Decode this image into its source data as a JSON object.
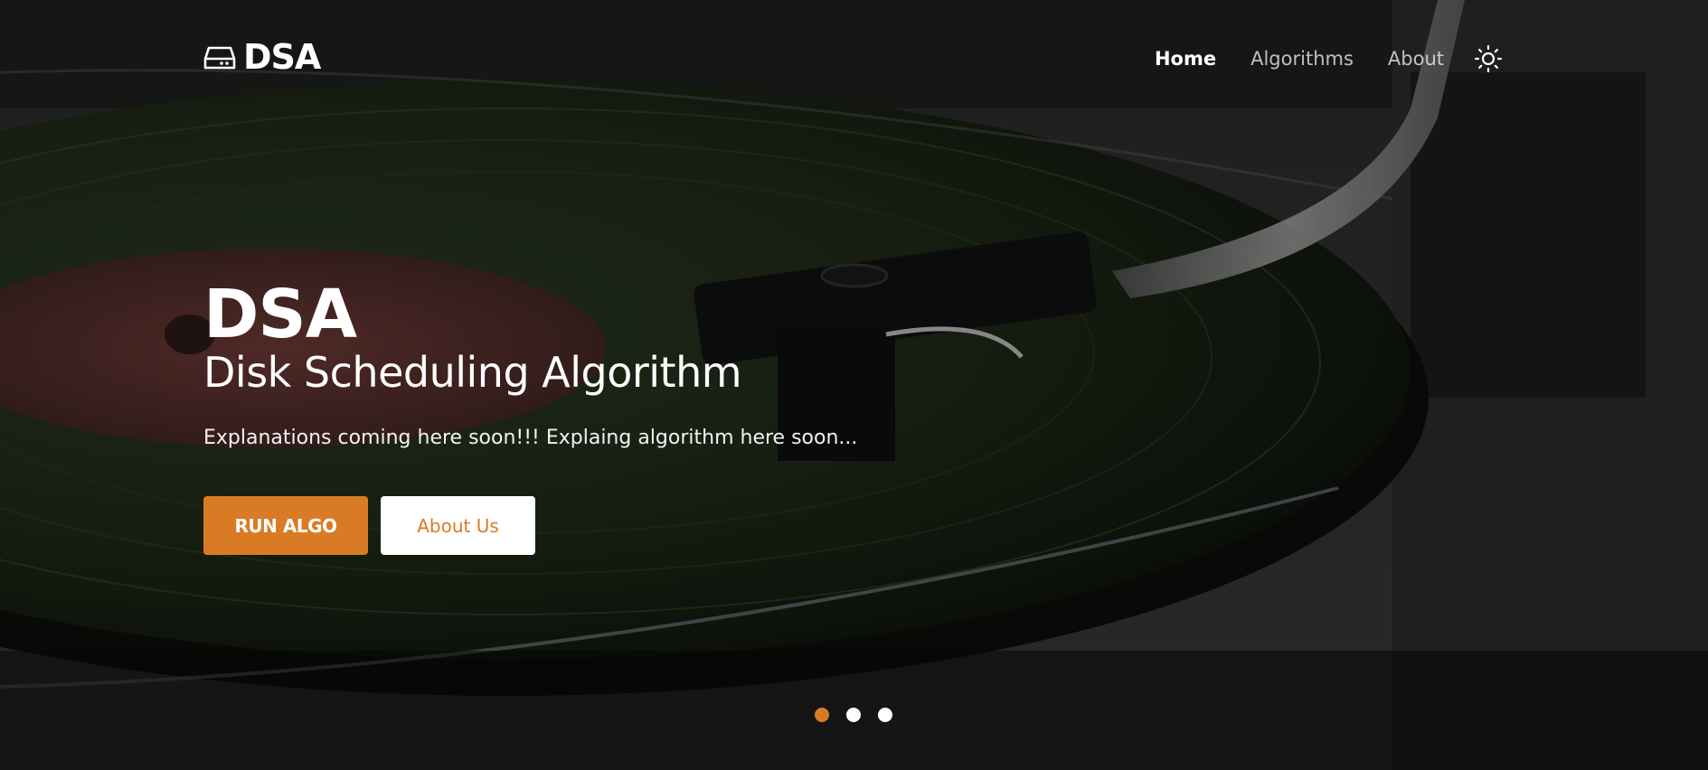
{
  "brand": {
    "name": "DSA",
    "icon": "hard-drive-icon"
  },
  "nav": {
    "items": [
      {
        "label": "Home",
        "active": true
      },
      {
        "label": "Algorithms",
        "active": false
      },
      {
        "label": "About",
        "active": false
      }
    ],
    "theme_toggle_icon": "sun-icon"
  },
  "hero": {
    "title": "DSA",
    "subtitle": "Disk Scheduling Algorithm",
    "description": "Explanations coming here soon!!! Explaing algorithm here soon...",
    "primary_button": "RUN ALGO",
    "secondary_button": "About Us"
  },
  "carousel": {
    "slide_count": 3,
    "active_index": 0
  },
  "colors": {
    "accent": "#d97b24",
    "text": "#ffffff"
  }
}
